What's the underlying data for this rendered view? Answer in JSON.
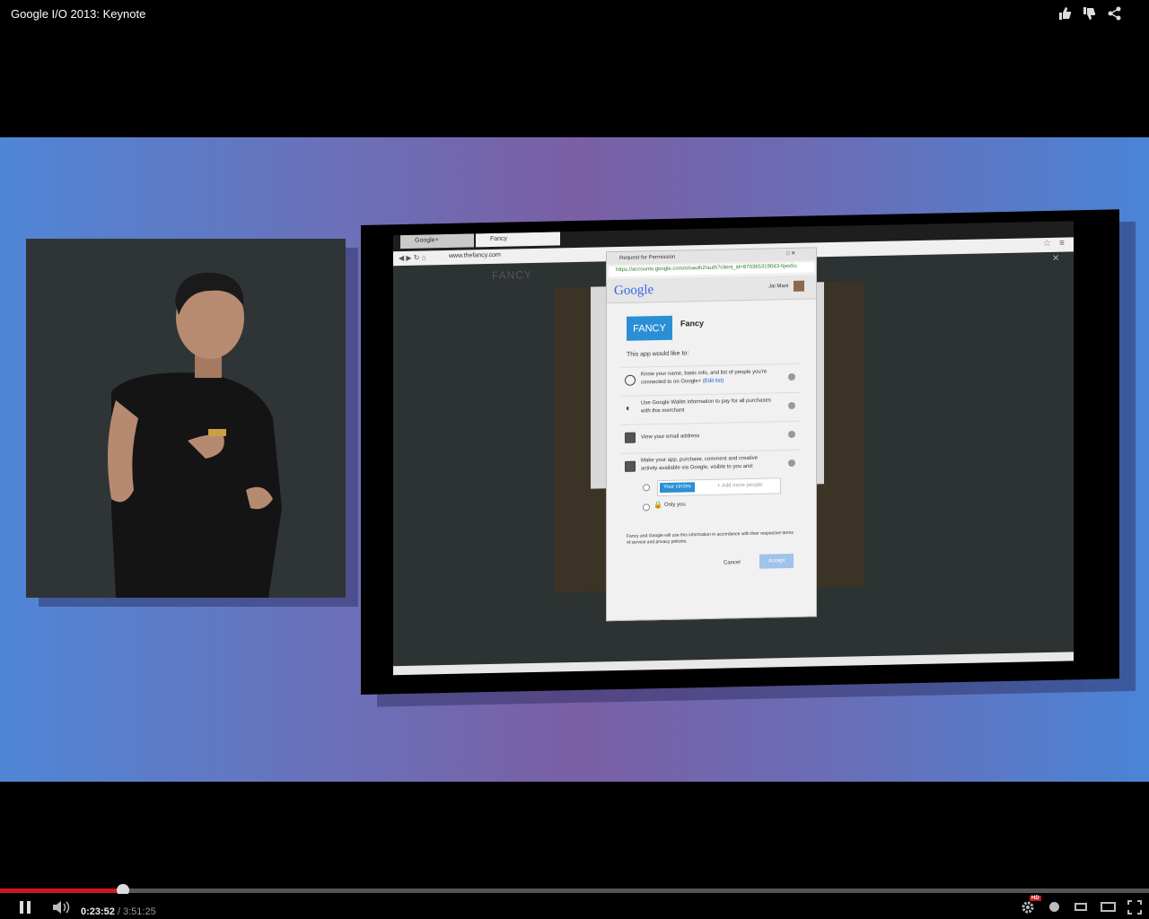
{
  "player": {
    "title": "Google I/O 2013: Keynote",
    "time_current": "0:23:52",
    "time_separator": "/",
    "time_total": "3:51:25",
    "progress": 0.107,
    "hd_badge": "HD",
    "icons": [
      "like-icon",
      "dislike-icon",
      "share-icon",
      "pause-icon",
      "volume-icon",
      "settings-icon",
      "annotations-icon",
      "small-player-icon",
      "large-player-icon",
      "fullscreen-icon"
    ]
  },
  "slide": {
    "browser": {
      "tabs": [
        "Google+",
        "Fancy"
      ],
      "url": "www.thefancy.com",
      "site_logo": "FANCY"
    },
    "dialog": {
      "window_title": "Request for Permission",
      "url": "https://accounts.google.com/o/oauth2/auth?client_id=870365319043-5jes5u",
      "brand": "Google",
      "user": "Jai Mani",
      "app_logo": "FANCY",
      "app_name": "Fancy",
      "intro": "This app would like to:",
      "permissions": [
        {
          "text": "Know your name, basic info, and list of people you're connected to on Google+",
          "link": "(Edit list)"
        },
        {
          "text": "Use Google Wallet information to pay for all purchases with this merchant",
          "link": ""
        },
        {
          "text": "View your email address",
          "link": ""
        },
        {
          "text": "Make your app, purchase, comment and creative activity available via Google, visible to you and:",
          "link": ""
        }
      ],
      "visibility_chip": "Your circles",
      "add_people_placeholder": "+ Add more people",
      "only_you": "Only you",
      "footer": "Fancy and Google will use this information in accordance with their respective terms of service and privacy policies.",
      "cancel": "Cancel",
      "accept": "Accept"
    }
  }
}
